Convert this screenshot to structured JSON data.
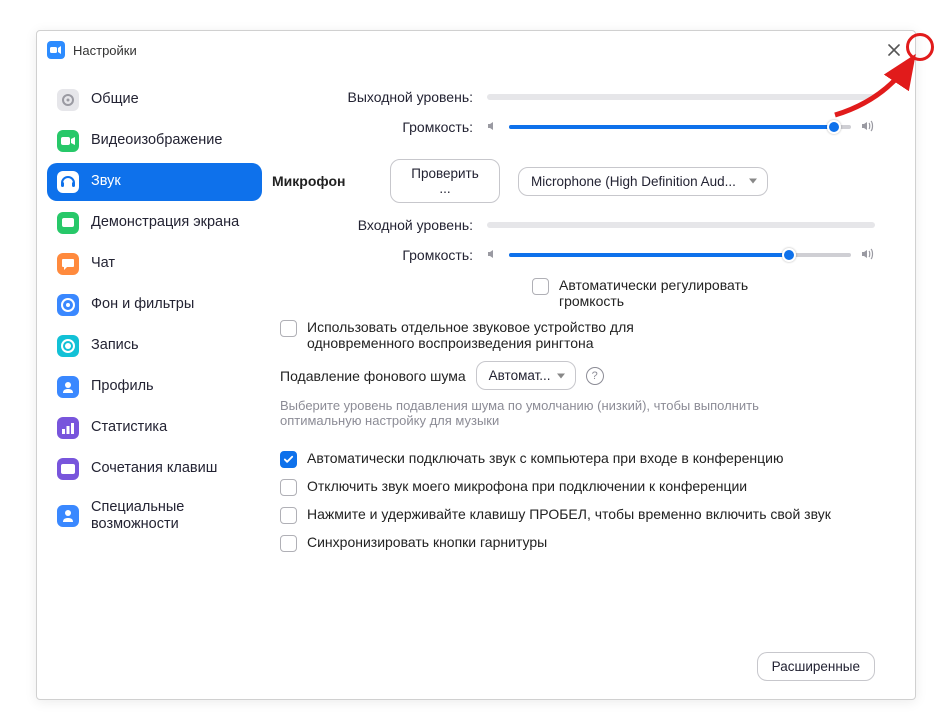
{
  "window": {
    "title": "Настройки"
  },
  "sidebar": {
    "items": [
      {
        "label": "Общие",
        "color": "#e6e6ea",
        "fg": "#9a9aa2"
      },
      {
        "label": "Видеоизображение",
        "color": "#27c869",
        "fg": "#fff"
      },
      {
        "label": "Звук",
        "color": "#ffffff",
        "fg": "#0e71eb",
        "active": true
      },
      {
        "label": "Демонстрация экрана",
        "color": "#27c869",
        "fg": "#fff"
      },
      {
        "label": "Чат",
        "color": "#ff8a3d",
        "fg": "#fff"
      },
      {
        "label": "Фон и фильтры",
        "color": "#3a88ff",
        "fg": "#fff"
      },
      {
        "label": "Запись",
        "color": "#12c1d6",
        "fg": "#fff"
      },
      {
        "label": "Профиль",
        "color": "#3a88ff",
        "fg": "#fff"
      },
      {
        "label": "Статистика",
        "color": "#7855dc",
        "fg": "#fff"
      },
      {
        "label": "Сочетания клавиш",
        "color": "#7855dc",
        "fg": "#fff"
      },
      {
        "label": "Специальные возможности",
        "color": "#3a88ff",
        "fg": "#fff"
      }
    ]
  },
  "audio": {
    "output_level_label": "Выходной уровень:",
    "volume_label": "Громкость:",
    "speaker_volume_pct": 95,
    "mic_section": "Микрофон",
    "test_btn": "Проверить ...",
    "mic_device": "Microphone (High Definition Aud...",
    "input_level_label": "Входной уровень:",
    "mic_volume_pct": 82,
    "auto_volume_label": "Автоматически регулировать громкость",
    "ringtone_label": "Использовать отдельное звуковое устройство для одновременного воспроизведения рингтона",
    "suppress_label": "Подавление фонового шума",
    "suppress_value": "Автомат...",
    "suppress_help": "Выберите уровень подавления шума по умолчанию (низкий), чтобы выполнить оптимальную настройку для музыки",
    "opt_auto_join": "Автоматически подключать звук с компьютера при входе в конференцию",
    "opt_mute_on_join": "Отключить звук моего микрофона при подключении к конференции",
    "opt_push_to_talk": "Нажмите и удерживайте клавишу ПРОБЕЛ, чтобы временно включить свой звук",
    "opt_sync_headset": "Синхронизировать кнопки гарнитуры",
    "advanced_btn": "Расширенные"
  }
}
